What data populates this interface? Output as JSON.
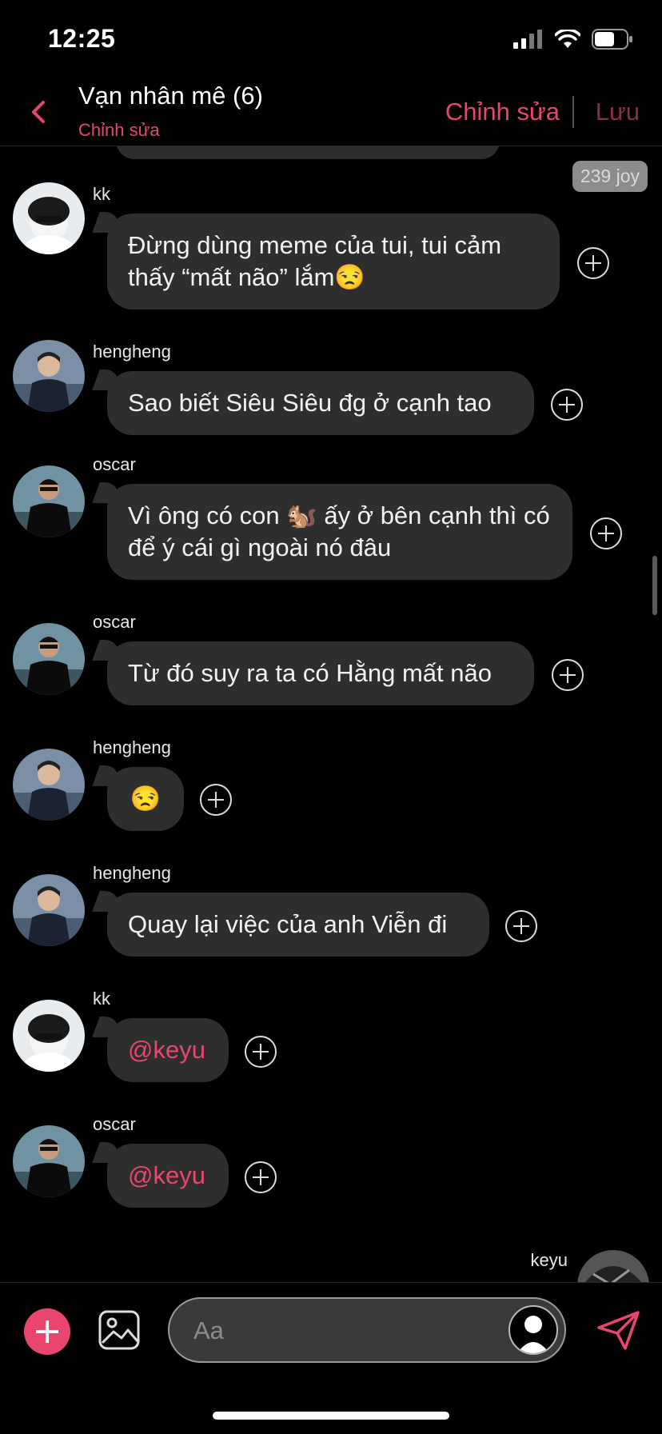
{
  "status_bar": {
    "time": "12:25"
  },
  "header": {
    "title": "Vạn nhân mê (6)",
    "subtitle": "Chỉnh sửa",
    "edit_label": "Chỉnh sửa",
    "save_label": "Lưu"
  },
  "badge": {
    "text": "239 joy"
  },
  "messages": [
    {
      "sender": "kk",
      "text": "Đừng dùng meme của tui, tui cảm thấy “mất não” lắm😒"
    },
    {
      "sender": "hengheng",
      "text": "Sao biết Siêu Siêu đg ở cạnh tao"
    },
    {
      "sender": "oscar",
      "text": "Vì ông có con 🐿️ ấy ở bên cạnh thì có để ý cái gì ngoài nó đâu"
    },
    {
      "sender": "oscar",
      "text": "Từ đó suy ra ta có Hằng mất não"
    },
    {
      "sender": "hengheng",
      "text": "😒"
    },
    {
      "sender": "hengheng",
      "text": "Quay lại việc của anh Viễn đi"
    },
    {
      "sender": "kk",
      "text": "@keyu"
    },
    {
      "sender": "oscar",
      "text": "@keyu"
    }
  ],
  "self": {
    "sender": "keyu"
  },
  "composer": {
    "placeholder": "Aa"
  },
  "icons": {
    "back": "chevron-left-icon",
    "add": "plus-icon",
    "image": "image-icon",
    "send": "send-icon",
    "message_add": "plus-circle-icon"
  },
  "colors": {
    "accent": "#e8466f",
    "bubble": "#2e2e2e",
    "background": "#000000"
  }
}
